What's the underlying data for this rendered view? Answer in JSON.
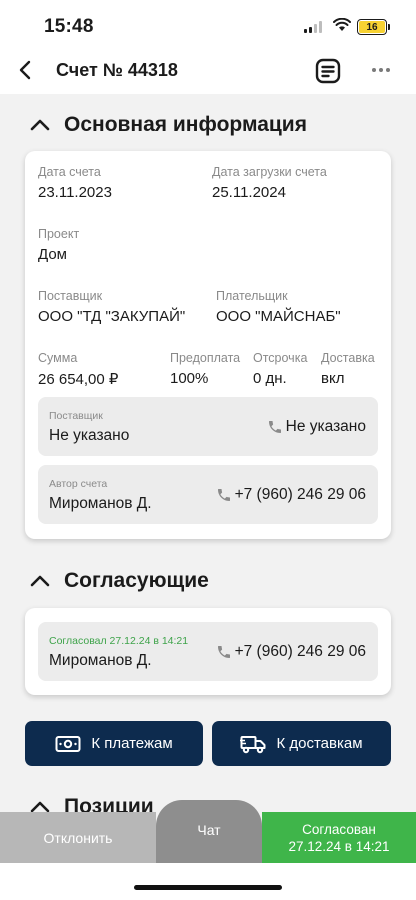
{
  "status_bar": {
    "time": "15:48",
    "battery": "16"
  },
  "nav": {
    "title": "Счет № 44318",
    "icons": [
      "back-arrow-icon",
      "document-icon",
      "more-icon"
    ]
  },
  "main_info": {
    "title": "Основная информация",
    "invoice_date_label": "Дата счета",
    "invoice_date": "23.11.2023",
    "upload_date_label": "Дата загрузки счета",
    "upload_date": "25.11.2024",
    "project_label": "Проект",
    "project": "Дом",
    "supplier_label": "Поставщик",
    "supplier": "ООО \"ТД \"ЗАКУПАЙ\"",
    "payer_label": "Плательщик",
    "payer": "ООО \"МАЙСНАБ\"",
    "sum_label": "Сумма",
    "sum": "26 654,00 ₽",
    "prepay_label": "Предоплата",
    "prepay": "100%",
    "delay_label": "Отсрочка",
    "delay": "0 дн.",
    "delivery_label": "Доставка",
    "delivery": "вкл",
    "supplier_contact": {
      "label": "Поставщик",
      "value": "Не указано",
      "phone": "Не указано"
    },
    "author_contact": {
      "label": "Автор счета",
      "value": "Мироманов Д.",
      "phone": "+7 (960) 246 29 06"
    }
  },
  "approvers": {
    "title": "Согласующие",
    "items": [
      {
        "status": "Согласовал 27.12.24 в 14:21",
        "name": "Мироманов Д.",
        "phone": "+7 (960) 246 29 06"
      }
    ]
  },
  "actions": {
    "payments": "К платежам",
    "deliveries": "К доставкам"
  },
  "positions": {
    "title": "Позиции"
  },
  "bottom_bar": {
    "reject": "Отклонить",
    "chat": "Чат",
    "approved_line1": "Согласован",
    "approved_line2": "27.12.24 в 14:21"
  },
  "colors": {
    "primary": "#0d2b4e",
    "success": "#3fb54a",
    "neutral": "#b7b7b7",
    "chat": "#8e8e8e",
    "approved_text": "#3ea34a"
  }
}
